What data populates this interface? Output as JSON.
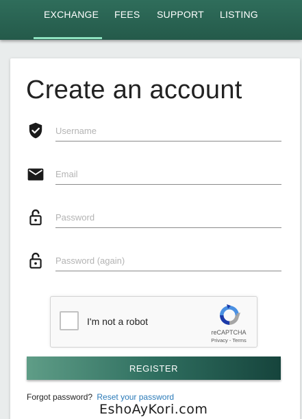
{
  "nav": {
    "items": [
      {
        "label": "EXCHANGE",
        "active": true
      },
      {
        "label": "FEES",
        "active": false
      },
      {
        "label": "SUPPORT",
        "active": false
      },
      {
        "label": "LISTING",
        "active": false
      }
    ]
  },
  "form": {
    "title": "Create an account",
    "fields": {
      "username": {
        "placeholder": "Username",
        "value": "",
        "icon": "shield-check-icon"
      },
      "email": {
        "placeholder": "Email",
        "value": "",
        "icon": "envelope-icon"
      },
      "password": {
        "placeholder": "Password",
        "value": "",
        "icon": "lock-open-icon"
      },
      "password_again": {
        "placeholder": "Password (again)",
        "value": "",
        "icon": "lock-open-icon"
      }
    },
    "recaptcha": {
      "label": "I'm not a robot",
      "brand": "reCAPTCHA",
      "privacy": "Privacy",
      "separator": " - ",
      "terms": "Terms",
      "checked": false
    },
    "register_label": "REGISTER",
    "forgot_text": "Forgot password?",
    "reset_link": "Reset your password"
  },
  "watermark": "EshoAyKori.com",
  "colors": {
    "nav_bg": "#2a6656",
    "nav_active_underline": "#8ee3c1",
    "button_gradient_start": "#5f9d87",
    "button_gradient_end": "#16443c",
    "link": "#2a7ab8"
  }
}
